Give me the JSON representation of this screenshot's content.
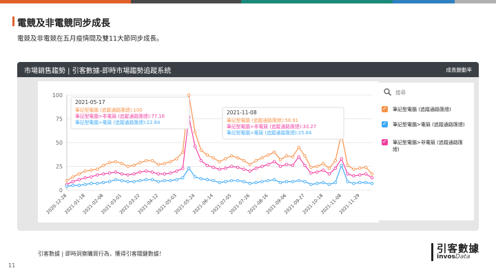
{
  "colors": {
    "orange": "#f7924a",
    "pink": "#f03ea0",
    "blue": "#3fa8f5",
    "header_bg": "#3a3f45",
    "accent_bars": [
      "#e0602a",
      "#4a4a4a",
      "#1a8a7a",
      "#2f7fc1",
      "#b0b0b0"
    ]
  },
  "slide": {
    "title": "電競及非電競同步成長",
    "subtitle": "電競及非電競在五月疫情間及雙11大節同步成長。"
  },
  "panel": {
    "title": "市場銷售趨勢 | 引客數據-即時市場趨勢追蹤系統",
    "right_label": "成長變動率"
  },
  "legend": {
    "search_placeholder": "搜尋",
    "items": [
      {
        "label": "筆記型電腦 (追蹤通路匯總)",
        "color": "#f7924a",
        "checked": true
      },
      {
        "label": "筆記型電腦>電競 (追蹤通路匯總)",
        "color": "#3fa8f5",
        "checked": true
      },
      {
        "label": "筆記型電腦>非電競 (追蹤通路匯總)",
        "color": "#f03ea0",
        "checked": true
      }
    ]
  },
  "tooltips": [
    {
      "date": "2021-05-17",
      "lines": [
        "筆記型電腦 (追蹤通路匯總):100",
        "筆記型電腦>非電競 (追蹤通路匯總):77.16",
        "筆記型電腦>電競 (追蹤通路匯總):22.84"
      ]
    },
    {
      "date": "2021-11-08",
      "lines": [
        "筆記型電腦 (追蹤通路匯總):58.91",
        "筆記型電腦>非電競 (追蹤通路匯總):33.27",
        "筆記型電腦>電競 (追蹤通路匯總):25.64"
      ]
    }
  ],
  "chart_data": {
    "type": "line",
    "ylim": [
      0,
      100
    ],
    "y_ticks": [
      0,
      25,
      50,
      75,
      100
    ],
    "x_tick_labels": [
      "2020-12-28",
      "2021-01-18",
      "2021-02-08",
      "2021-03-01",
      "2021-03-22",
      "2021-04-12",
      "2021-05-03",
      "2021-05-24",
      "2021-06-14",
      "2021-07-05",
      "2021-07-26",
      "2021-08-16",
      "2021-09-06",
      "2021-09-27",
      "2021-10-18",
      "2021-11-08",
      "2021-11-29"
    ],
    "x_tick_indices": [
      0,
      3,
      6,
      9,
      12,
      15,
      18,
      21,
      24,
      27,
      30,
      33,
      36,
      39,
      42,
      45,
      48
    ],
    "series": [
      {
        "name": "筆記型電腦 (追蹤通路匯總)",
        "color": "#f7924a",
        "values": [
          10,
          14,
          17,
          20,
          21,
          22,
          26,
          29,
          30,
          28,
          25,
          26,
          29,
          31,
          31,
          27,
          28,
          30,
          33,
          40,
          100,
          61,
          42,
          37,
          34,
          30,
          33,
          36,
          34,
          31,
          27,
          31,
          34,
          37,
          40,
          32,
          36,
          35,
          45,
          36,
          24,
          25,
          28,
          23,
          31,
          59,
          26,
          22,
          23,
          24,
          17
        ]
      },
      {
        "name": "筆記型電腦>非電競 (追蹤通路匯總)",
        "color": "#f03ea0",
        "values": [
          6,
          9,
          11,
          13,
          14,
          16,
          17,
          18,
          19,
          17,
          16,
          17,
          19,
          20,
          19,
          17,
          17,
          18,
          20,
          23,
          77,
          46,
          31,
          26,
          24,
          22,
          23,
          25,
          24,
          22,
          20,
          23,
          25,
          27,
          30,
          25,
          27,
          26,
          35,
          26,
          18,
          19,
          21,
          17,
          23,
          33,
          17,
          15,
          16,
          17,
          13
        ]
      },
      {
        "name": "筆記型電腦>電競 (追蹤通路匯總)",
        "color": "#3fa8f5",
        "values": [
          4,
          5,
          5,
          6,
          7,
          7,
          8,
          9,
          11,
          10,
          9,
          9,
          10,
          11,
          11,
          9,
          10,
          10,
          11,
          13,
          23,
          14,
          12,
          11,
          10,
          8,
          9,
          10,
          10,
          9,
          7,
          8,
          9,
          10,
          11,
          8,
          9,
          9,
          10,
          9,
          6,
          7,
          8,
          6,
          8,
          26,
          9,
          7,
          8,
          8,
          7
        ]
      }
    ]
  }
}
